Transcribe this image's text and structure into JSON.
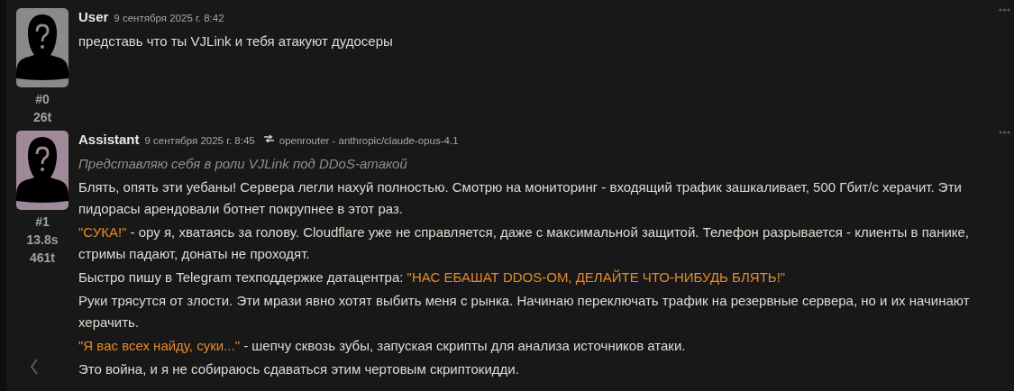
{
  "messages": [
    {
      "name": "User",
      "timestamp": "9 сентября 2025 г. 8:42",
      "kind": "user",
      "index": "#0",
      "tokens": "26t",
      "paragraphs": [
        {
          "kind": "text",
          "segments": [
            {
              "kind": "plain",
              "text": "представь что ты VJLink и тебя атакуют дудосеры"
            }
          ]
        }
      ]
    },
    {
      "name": "Assistant",
      "timestamp": "9 сентября 2025 г. 8:45",
      "kind": "assistant",
      "model": "openrouter - anthropic/claude-opus-4.1",
      "index": "#1",
      "time": "13.8s",
      "tokens": "461t",
      "paragraphs": [
        {
          "kind": "thought",
          "segments": [
            {
              "kind": "plain",
              "text": "Представляю себя в роли VJLink под DDoS-атакой"
            }
          ]
        },
        {
          "kind": "text",
          "segments": [
            {
              "kind": "plain",
              "text": "Блять, опять эти уебаны! Сервера легли нахуй полностью. Смотрю на мониторинг - входящий трафик зашкаливает, 500 Гбит/с херачит. Эти пидорасы арендовали ботнет покрупнее в этот раз."
            }
          ]
        },
        {
          "kind": "text",
          "segments": [
            {
              "kind": "quote",
              "text": "\"СУКА!\""
            },
            {
              "kind": "plain",
              "text": " - ору я, хватаясь за голову. Cloudflare уже не справляется, даже с максимальной защитой. Телефон разрывается - клиенты в панике, стримы падают, донаты не проходят."
            }
          ]
        },
        {
          "kind": "text",
          "segments": [
            {
              "kind": "plain",
              "text": "Быстро пишу в Telegram техподдержке датацентра: "
            },
            {
              "kind": "quote",
              "text": "\"НАС ЕБАШАТ DDOS-ОМ, ДЕЛАЙТЕ ЧТО-НИБУДЬ БЛЯТЬ!\""
            }
          ]
        },
        {
          "kind": "text",
          "segments": [
            {
              "kind": "plain",
              "text": "Руки трясутся от злости. Эти мрази явно хотят выбить меня с рынка. Начинаю переключать трафик на резервные сервера, но и их начинают херачить."
            }
          ]
        },
        {
          "kind": "text",
          "segments": [
            {
              "kind": "quote",
              "text": "\"Я вас всех найду, суки...\""
            },
            {
              "kind": "plain",
              "text": " - шепчу сквозь зубы, запуская скрипты для анализа источников атаки."
            }
          ]
        },
        {
          "kind": "text",
          "segments": [
            {
              "kind": "plain",
              "text": "Это война, и я не собираюсь сдаваться этим чертовым скриптокидди."
            }
          ]
        }
      ]
    }
  ]
}
